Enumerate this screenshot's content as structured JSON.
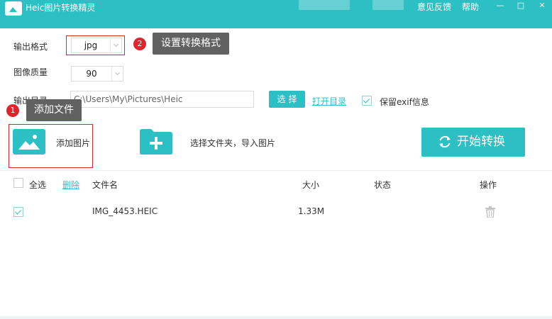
{
  "window": {
    "title": "Heic图片转换精灵",
    "feedback_label": "意见反馈",
    "help_label": "帮助",
    "minimize_glyph": "—",
    "maximize_glyph": "□",
    "close_glyph": "✕"
  },
  "settings": {
    "format_label": "输出格式",
    "format_value": "jpg",
    "quality_label": "图像质量",
    "quality_value": "90",
    "output_dir_label": "输出目录",
    "output_dir_value": "C:\\Users\\My\\Pictures\\Heic",
    "choose_button": "选 择",
    "open_dir_link": "打开目录",
    "keep_exif_label": "保留exif信息",
    "keep_exif_checked": true
  },
  "annotations": {
    "step1_number": "1",
    "step1_text": "添加文件",
    "step2_number": "2",
    "step2_text": "设置转换格式"
  },
  "actions": {
    "add_image_label": "添加图片",
    "add_folder_label": "选择文件夹，导入图片",
    "start_convert_label": "开始转换"
  },
  "table": {
    "select_all_label": "全选",
    "delete_link": "删除",
    "headers": {
      "filename": "文件名",
      "size": "大小",
      "status": "状态",
      "action": "操作"
    },
    "rows": [
      {
        "checked": true,
        "filename": "IMG_4453.HEIC",
        "size": "1.33M",
        "status": ""
      }
    ]
  },
  "colors": {
    "accent": "#2cc0c4",
    "annotation_red": "#e0242b",
    "tooltip_bg": "#616161"
  }
}
